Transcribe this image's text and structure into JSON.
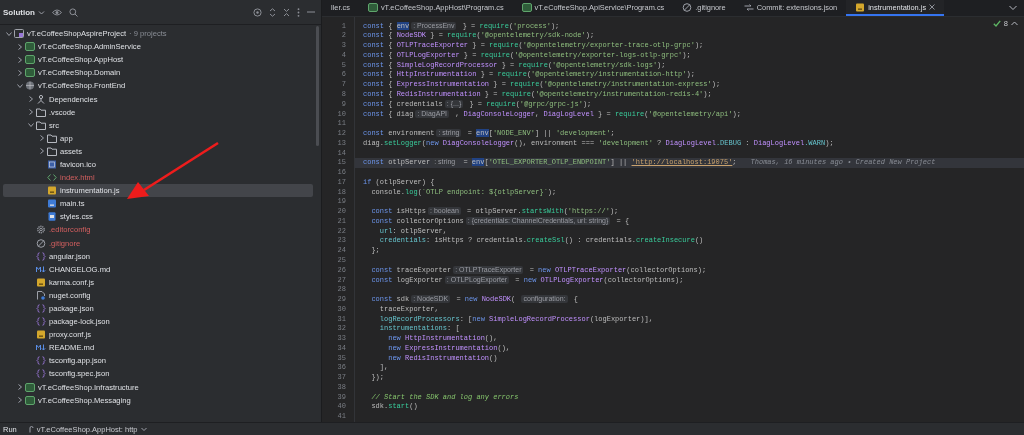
{
  "sidebar": {
    "title": "Solution",
    "tree": [
      {
        "label": "vT.eCoffeeShopAspireProject",
        "note": "· 9 projects",
        "kind": "solution",
        "selected": false,
        "unversioned": false,
        "expanded": true,
        "children": [
          {
            "label": "vT.eCoffeeShop.AdminService",
            "kind": "project",
            "selected": false,
            "unversioned": false,
            "expanded": false
          },
          {
            "label": "vT.eCoffeeShop.AppHost",
            "kind": "project",
            "selected": false,
            "unversioned": false,
            "expanded": false
          },
          {
            "label": "vT.eCoffeeShop.Domain",
            "kind": "project",
            "selected": false,
            "unversioned": false,
            "expanded": false
          },
          {
            "label": "vT.eCoffeeShop.FrontEnd",
            "kind": "webproject",
            "selected": false,
            "unversioned": false,
            "expanded": true,
            "children": [
              {
                "label": "Dependencies",
                "kind": "dependencies",
                "selected": false,
                "unversioned": false,
                "expanded": false
              },
              {
                "label": ".vscode",
                "kind": "folder",
                "selected": false,
                "unversioned": false,
                "expanded": false
              },
              {
                "label": "src",
                "kind": "folder",
                "selected": false,
                "unversioned": false,
                "expanded": true,
                "children": [
                  {
                    "label": "app",
                    "kind": "folder",
                    "selected": false,
                    "unversioned": false,
                    "expanded": false
                  },
                  {
                    "label": "assets",
                    "kind": "folder",
                    "selected": false,
                    "unversioned": false,
                    "expanded": false
                  },
                  {
                    "label": "favicon.ico",
                    "kind": "image",
                    "selected": false,
                    "unversioned": false
                  },
                  {
                    "label": "index.html",
                    "kind": "html",
                    "selected": false,
                    "unversioned": true
                  },
                  {
                    "label": "instrumentation.js",
                    "kind": "script",
                    "selected": true,
                    "unversioned": false
                  },
                  {
                    "label": "main.ts",
                    "kind": "typescript",
                    "selected": false,
                    "unversioned": false
                  },
                  {
                    "label": "styles.css",
                    "kind": "stylesheet",
                    "selected": false,
                    "unversioned": false
                  }
                ]
              },
              {
                "label": ".editorconfig",
                "kind": "settings",
                "selected": false,
                "unversioned": true
              },
              {
                "label": ".gitignore",
                "kind": "ignore",
                "selected": false,
                "unversioned": true
              },
              {
                "label": "angular.json",
                "kind": "json",
                "selected": false,
                "unversioned": false
              },
              {
                "label": "CHANGELOG.md",
                "kind": "markdown",
                "selected": false,
                "unversioned": false
              },
              {
                "label": "karma.conf.js",
                "kind": "script",
                "selected": false,
                "unversioned": false
              },
              {
                "label": "nuget.config",
                "kind": "config",
                "selected": false,
                "unversioned": false
              },
              {
                "label": "package.json",
                "kind": "json",
                "selected": false,
                "unversioned": false
              },
              {
                "label": "package-lock.json",
                "kind": "json",
                "selected": false,
                "unversioned": false
              },
              {
                "label": "proxy.conf.js",
                "kind": "script",
                "selected": false,
                "unversioned": false
              },
              {
                "label": "README.md",
                "kind": "markdown",
                "selected": false,
                "unversioned": false
              },
              {
                "label": "tsconfig.app.json",
                "kind": "json",
                "selected": false,
                "unversioned": false
              },
              {
                "label": "tsconfig.spec.json",
                "kind": "json",
                "selected": false,
                "unversioned": false
              }
            ]
          },
          {
            "label": "vT.eCoffeeShop.Infrastructure",
            "kind": "project",
            "selected": false,
            "unversioned": false,
            "expanded": false
          },
          {
            "label": "vT.eCoffeeShop.Messaging",
            "kind": "project",
            "selected": false,
            "unversioned": false,
            "expanded": false
          }
        ]
      }
    ]
  },
  "tabs": [
    {
      "label": "ller.cs",
      "kind": "plain",
      "selected": false
    },
    {
      "label": "vT.eCoffeeShop.AppHost\\Program.cs",
      "kind": "csharp",
      "selected": false
    },
    {
      "label": "vT.eCoffeeShop.ApiService\\Program.cs",
      "kind": "csharp",
      "selected": false
    },
    {
      "label": ".gitignore",
      "kind": "ignore",
      "selected": false
    },
    {
      "label": "Commit: extensions.json",
      "kind": "commit",
      "selected": false
    },
    {
      "label": "instrumentation.js",
      "kind": "script",
      "selected": true
    }
  ],
  "inspections": {
    "count": "8"
  },
  "editor": {
    "lines": [
      {
        "n": "1",
        "current": false,
        "tokens": [
          {
            "kind": "keyword",
            "text": "const"
          },
          {
            "kind": "plain",
            "text": " { "
          },
          {
            "kind": "highlight",
            "text": "env"
          },
          {
            "kind": "hint",
            "text": ": ProcessEnv"
          },
          {
            "kind": "plain",
            "text": " } = "
          },
          {
            "kind": "call",
            "text": "require"
          },
          {
            "kind": "plain",
            "text": "("
          },
          {
            "kind": "string",
            "text": "'process'"
          },
          {
            "kind": "plain",
            "text": ");"
          }
        ]
      },
      {
        "n": "2",
        "current": false,
        "tokens": [
          {
            "kind": "keyword",
            "text": "const"
          },
          {
            "kind": "plain",
            "text": " { "
          },
          {
            "kind": "type",
            "text": "NodeSDK"
          },
          {
            "kind": "plain",
            "text": " } = "
          },
          {
            "kind": "call",
            "text": "require"
          },
          {
            "kind": "plain",
            "text": "("
          },
          {
            "kind": "string",
            "text": "'@opentelemetry/sdk-node'"
          },
          {
            "kind": "plain",
            "text": ");"
          }
        ]
      },
      {
        "n": "3",
        "current": false,
        "tokens": [
          {
            "kind": "keyword",
            "text": "const"
          },
          {
            "kind": "plain",
            "text": " { "
          },
          {
            "kind": "type",
            "text": "OTLPTraceExporter"
          },
          {
            "kind": "plain",
            "text": " } = "
          },
          {
            "kind": "call",
            "text": "require"
          },
          {
            "kind": "plain",
            "text": "("
          },
          {
            "kind": "string",
            "text": "'@opentelemetry/exporter-trace-otlp-grpc'"
          },
          {
            "kind": "plain",
            "text": ");"
          }
        ]
      },
      {
        "n": "4",
        "current": false,
        "tokens": [
          {
            "kind": "keyword",
            "text": "const"
          },
          {
            "kind": "plain",
            "text": " { "
          },
          {
            "kind": "type",
            "text": "OTLPLogExporter"
          },
          {
            "kind": "plain",
            "text": " } = "
          },
          {
            "kind": "call",
            "text": "require"
          },
          {
            "kind": "plain",
            "text": "("
          },
          {
            "kind": "string",
            "text": "'@opentelemetry/exporter-logs-otlp-grpc'"
          },
          {
            "kind": "plain",
            "text": ");"
          }
        ]
      },
      {
        "n": "5",
        "current": false,
        "tokens": [
          {
            "kind": "keyword",
            "text": "const"
          },
          {
            "kind": "plain",
            "text": " { "
          },
          {
            "kind": "type",
            "text": "SimpleLogRecordProcessor"
          },
          {
            "kind": "plain",
            "text": " } = "
          },
          {
            "kind": "call",
            "text": "require"
          },
          {
            "kind": "plain",
            "text": "("
          },
          {
            "kind": "string",
            "text": "'@opentelemetry/sdk-logs'"
          },
          {
            "kind": "plain",
            "text": ");"
          }
        ]
      },
      {
        "n": "6",
        "current": false,
        "tokens": [
          {
            "kind": "keyword",
            "text": "const"
          },
          {
            "kind": "plain",
            "text": " { "
          },
          {
            "kind": "type",
            "text": "HttpInstrumentation"
          },
          {
            "kind": "plain",
            "text": " } = "
          },
          {
            "kind": "call",
            "text": "require"
          },
          {
            "kind": "plain",
            "text": "("
          },
          {
            "kind": "string",
            "text": "'@opentelemetry/instrumentation-http'"
          },
          {
            "kind": "plain",
            "text": ");"
          }
        ]
      },
      {
        "n": "7",
        "current": false,
        "tokens": [
          {
            "kind": "keyword",
            "text": "const"
          },
          {
            "kind": "plain",
            "text": " { "
          },
          {
            "kind": "type",
            "text": "ExpressInstrumentation"
          },
          {
            "kind": "plain",
            "text": " } = "
          },
          {
            "kind": "call",
            "text": "require"
          },
          {
            "kind": "plain",
            "text": "("
          },
          {
            "kind": "string",
            "text": "'@opentelemetry/instrumentation-express'"
          },
          {
            "kind": "plain",
            "text": ");"
          }
        ]
      },
      {
        "n": "8",
        "current": false,
        "tokens": [
          {
            "kind": "keyword",
            "text": "const"
          },
          {
            "kind": "plain",
            "text": " { "
          },
          {
            "kind": "type",
            "text": "RedisInstrumentation"
          },
          {
            "kind": "plain",
            "text": " } = "
          },
          {
            "kind": "call",
            "text": "require"
          },
          {
            "kind": "plain",
            "text": "("
          },
          {
            "kind": "string",
            "text": "'@opentelemetry/instrumentation-redis-4'"
          },
          {
            "kind": "plain",
            "text": ");"
          }
        ]
      },
      {
        "n": "9",
        "current": false,
        "tokens": [
          {
            "kind": "keyword",
            "text": "const"
          },
          {
            "kind": "plain",
            "text": " { credentials"
          },
          {
            "kind": "hint",
            "text": ": {...}"
          },
          {
            "kind": "plain",
            "text": " } = "
          },
          {
            "kind": "call",
            "text": "require"
          },
          {
            "kind": "plain",
            "text": "("
          },
          {
            "kind": "string",
            "text": "'@grpc/grpc-js'"
          },
          {
            "kind": "plain",
            "text": ");"
          }
        ]
      },
      {
        "n": "10",
        "current": false,
        "tokens": [
          {
            "kind": "keyword",
            "text": "const"
          },
          {
            "kind": "plain",
            "text": " { diag"
          },
          {
            "kind": "hint",
            "text": ": DiagAPI"
          },
          {
            "kind": "plain",
            "text": " , "
          },
          {
            "kind": "type",
            "text": "DiagConsoleLogger"
          },
          {
            "kind": "plain",
            "text": ", "
          },
          {
            "kind": "type",
            "text": "DiagLogLevel"
          },
          {
            "kind": "plain",
            "text": " } = "
          },
          {
            "kind": "call",
            "text": "require"
          },
          {
            "kind": "plain",
            "text": "("
          },
          {
            "kind": "string",
            "text": "'@opentelemetry/api'"
          },
          {
            "kind": "plain",
            "text": ");"
          }
        ]
      },
      {
        "n": "11",
        "current": false
      },
      {
        "n": "12",
        "current": false,
        "tokens": [
          {
            "kind": "keyword",
            "text": "const"
          },
          {
            "kind": "plain",
            "text": " environment"
          },
          {
            "kind": "hint",
            "text": ": string"
          },
          {
            "kind": "plain",
            "text": " = "
          },
          {
            "kind": "highlight",
            "text": "env"
          },
          {
            "kind": "plain",
            "text": "["
          },
          {
            "kind": "string",
            "text": "'NODE_ENV'"
          },
          {
            "kind": "plain",
            "text": "] || "
          },
          {
            "kind": "string",
            "text": "'development'"
          },
          {
            "kind": "plain",
            "text": ";"
          }
        ]
      },
      {
        "n": "13",
        "current": false,
        "tokens": [
          {
            "kind": "plain",
            "text": "diag."
          },
          {
            "kind": "call",
            "text": "setLogger"
          },
          {
            "kind": "plain",
            "text": "("
          },
          {
            "kind": "keyword",
            "text": "new"
          },
          {
            "kind": "type",
            "text": " DiagConsoleLogger"
          },
          {
            "kind": "plain",
            "text": "(), environment === "
          },
          {
            "kind": "string",
            "text": "'development'"
          },
          {
            "kind": "plain",
            "text": " ? "
          },
          {
            "kind": "type",
            "text": "DiagLogLevel"
          },
          {
            "kind": "property",
            "text": ".DEBUG"
          },
          {
            "kind": "plain",
            "text": " : "
          },
          {
            "kind": "type",
            "text": "DiagLogLevel"
          },
          {
            "kind": "property",
            "text": ".WARN"
          },
          {
            "kind": "plain",
            "text": ");"
          }
        ]
      },
      {
        "n": "14",
        "current": false
      },
      {
        "n": "15",
        "current": true,
        "tokens": [
          {
            "kind": "keyword",
            "text": "const"
          },
          {
            "kind": "plain",
            "text": " otlpServer"
          },
          {
            "kind": "hint",
            "text": ": string"
          },
          {
            "kind": "plain",
            "text": " = "
          },
          {
            "kind": "highlight",
            "text": "env"
          },
          {
            "kind": "plain",
            "text": "["
          },
          {
            "kind": "string",
            "text": "'OTEL_EXPORTER_OTLP_ENDPOINT'"
          },
          {
            "kind": "plain",
            "text": "] || "
          },
          {
            "kind": "url",
            "text": "'http://localhost:19075'"
          },
          {
            "kind": "plain",
            "text": ";"
          },
          {
            "kind": "blame",
            "text": "Thomas, 16 minutes ago • Created New Project"
          }
        ]
      },
      {
        "n": "16",
        "current": false
      },
      {
        "n": "17",
        "current": false,
        "tokens": [
          {
            "kind": "keyword",
            "text": "if"
          },
          {
            "kind": "plain",
            "text": " (otlpServer) {"
          }
        ]
      },
      {
        "n": "18",
        "current": false,
        "tokens": [
          {
            "kind": "plain",
            "text": "  console."
          },
          {
            "kind": "call",
            "text": "log"
          },
          {
            "kind": "plain",
            "text": "("
          },
          {
            "kind": "string",
            "text": "`OTLP endpoint: ${otlpServer}`"
          },
          {
            "kind": "plain",
            "text": ");"
          }
        ]
      },
      {
        "n": "19",
        "current": false
      },
      {
        "n": "20",
        "current": false,
        "tokens": [
          {
            "kind": "keyword",
            "text": "  const"
          },
          {
            "kind": "plain",
            "text": " isHttps"
          },
          {
            "kind": "hint",
            "text": ": boolean"
          },
          {
            "kind": "plain",
            "text": " = otlpServer."
          },
          {
            "kind": "call",
            "text": "startsWith"
          },
          {
            "kind": "plain",
            "text": "("
          },
          {
            "kind": "string",
            "text": "'https://'"
          },
          {
            "kind": "plain",
            "text": ");"
          }
        ]
      },
      {
        "n": "21",
        "current": false,
        "tokens": [
          {
            "kind": "keyword",
            "text": "  const"
          },
          {
            "kind": "plain",
            "text": " collectorOptions"
          },
          {
            "kind": "hint",
            "text": ": {credentials: ChannelCredentials, url: string}"
          },
          {
            "kind": "plain",
            "text": " = {"
          }
        ]
      },
      {
        "n": "22",
        "current": false,
        "tokens": [
          {
            "kind": "property",
            "text": "    url"
          },
          {
            "kind": "plain",
            "text": ": otlpServer,"
          }
        ]
      },
      {
        "n": "23",
        "current": false,
        "tokens": [
          {
            "kind": "property",
            "text": "    credentials"
          },
          {
            "kind": "plain",
            "text": ": isHttps ? credentials."
          },
          {
            "kind": "call",
            "text": "createSsl"
          },
          {
            "kind": "plain",
            "text": "() : credentials."
          },
          {
            "kind": "call",
            "text": "createInsecure"
          },
          {
            "kind": "plain",
            "text": "()"
          }
        ]
      },
      {
        "n": "24",
        "current": false,
        "tokens": [
          {
            "kind": "plain",
            "text": "  };"
          }
        ]
      },
      {
        "n": "25",
        "current": false
      },
      {
        "n": "26",
        "current": false,
        "tokens": [
          {
            "kind": "keyword",
            "text": "  const"
          },
          {
            "kind": "plain",
            "text": " traceExporter"
          },
          {
            "kind": "hint",
            "text": ": OTLPTraceExporter"
          },
          {
            "kind": "plain",
            "text": " = "
          },
          {
            "kind": "keyword",
            "text": "new"
          },
          {
            "kind": "type",
            "text": " OTLPTraceExporter"
          },
          {
            "kind": "plain",
            "text": "(collectorOptions);"
          }
        ]
      },
      {
        "n": "27",
        "current": false,
        "tokens": [
          {
            "kind": "keyword",
            "text": "  const"
          },
          {
            "kind": "plain",
            "text": " logExporter"
          },
          {
            "kind": "hint",
            "text": ": OTLPLogExporter"
          },
          {
            "kind": "plain",
            "text": " = "
          },
          {
            "kind": "keyword",
            "text": "new"
          },
          {
            "kind": "type",
            "text": " OTLPLogExporter"
          },
          {
            "kind": "plain",
            "text": "(collectorOptions);"
          }
        ]
      },
      {
        "n": "28",
        "current": false
      },
      {
        "n": "29",
        "current": false,
        "tokens": [
          {
            "kind": "keyword",
            "text": "  const"
          },
          {
            "kind": "plain",
            "text": " sdk"
          },
          {
            "kind": "hint",
            "text": ": NodeSDK"
          },
          {
            "kind": "plain",
            "text": " = "
          },
          {
            "kind": "keyword",
            "text": "new"
          },
          {
            "kind": "type",
            "text": " NodeSDK"
          },
          {
            "kind": "plain",
            "text": "( "
          },
          {
            "kind": "hint",
            "text": "configuration:"
          },
          {
            "kind": "plain",
            "text": " {"
          }
        ]
      },
      {
        "n": "30",
        "current": false,
        "tokens": [
          {
            "kind": "plain",
            "text": "    traceExporter,"
          }
        ]
      },
      {
        "n": "31",
        "current": false,
        "tokens": [
          {
            "kind": "property",
            "text": "    logRecordProcessors"
          },
          {
            "kind": "plain",
            "text": ": ["
          },
          {
            "kind": "keyword",
            "text": "new"
          },
          {
            "kind": "type",
            "text": " SimpleLogRecordProcessor"
          },
          {
            "kind": "plain",
            "text": "(logExporter)],"
          }
        ]
      },
      {
        "n": "32",
        "current": false,
        "tokens": [
          {
            "kind": "property",
            "text": "    instrumentations"
          },
          {
            "kind": "plain",
            "text": ": ["
          }
        ]
      },
      {
        "n": "33",
        "current": false,
        "tokens": [
          {
            "kind": "keyword",
            "text": "      new"
          },
          {
            "kind": "type",
            "text": " HttpInstrumentation"
          },
          {
            "kind": "plain",
            "text": "(),"
          }
        ]
      },
      {
        "n": "34",
        "current": false,
        "tokens": [
          {
            "kind": "keyword",
            "text": "      new"
          },
          {
            "kind": "type",
            "text": " ExpressInstrumentation"
          },
          {
            "kind": "plain",
            "text": "(),"
          }
        ]
      },
      {
        "n": "35",
        "current": false,
        "tokens": [
          {
            "kind": "keyword",
            "text": "      new"
          },
          {
            "kind": "type",
            "text": " RedisInstrumentation"
          },
          {
            "kind": "plain",
            "text": "()"
          }
        ]
      },
      {
        "n": "36",
        "current": false,
        "tokens": [
          {
            "kind": "plain",
            "text": "    ],"
          }
        ]
      },
      {
        "n": "37",
        "current": false,
        "tokens": [
          {
            "kind": "plain",
            "text": "  });"
          }
        ]
      },
      {
        "n": "38",
        "current": false
      },
      {
        "n": "39",
        "current": false,
        "tokens": [
          {
            "kind": "comment",
            "text": "  // Start the SDK and log any errors"
          }
        ]
      },
      {
        "n": "40",
        "current": false,
        "tokens": [
          {
            "kind": "plain",
            "text": "  sdk."
          },
          {
            "kind": "call",
            "text": "start"
          },
          {
            "kind": "plain",
            "text": "()"
          }
        ]
      },
      {
        "n": "41",
        "current": false
      }
    ]
  },
  "run_bar": {
    "label": "Run",
    "configuration": "vT.eCoffeeShop.AppHost: http"
  }
}
